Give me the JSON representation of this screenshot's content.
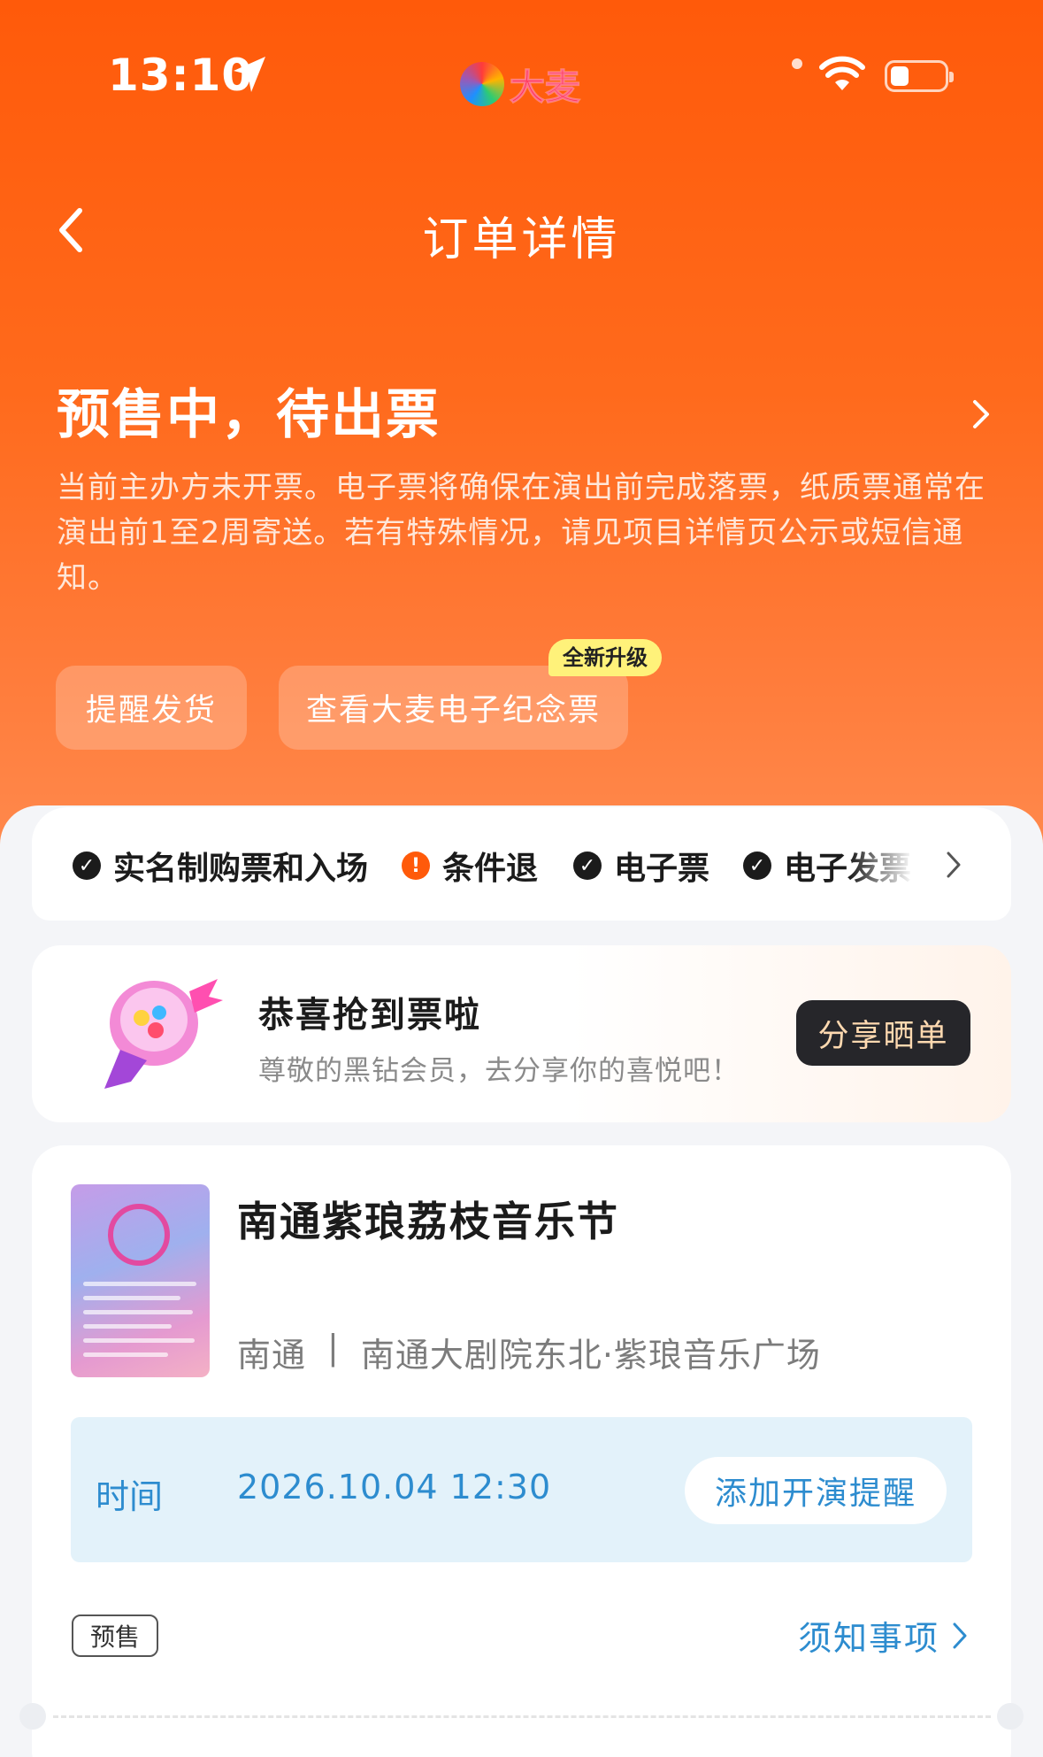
{
  "status_bar": {
    "time": "13:10",
    "brand": "大麦"
  },
  "nav": {
    "title": "订单详情"
  },
  "order": {
    "status": "预售中，待出票",
    "description": "当前主办方未开票。电子票将确保在演出前完成落票，纸质票通常在演出前1至2周寄送。若有特殊情况，请见项目详情页公示或短信通知。"
  },
  "actions": {
    "remind_label": "提醒发货",
    "eticket_label": "查看大麦电子纪念票",
    "new_badge": "全新升级"
  },
  "policies": [
    {
      "label": "实名制购票和入场",
      "icon": "check-circle-icon"
    },
    {
      "label": "条件退",
      "icon": "warning-circle-icon"
    },
    {
      "label": "电子票",
      "icon": "check-circle-icon"
    },
    {
      "label": "电子发票",
      "icon": "check-circle-icon"
    }
  ],
  "share": {
    "title": "恭喜抢到票啦",
    "subtitle": "尊敬的黑钻会员，去分享你的喜悦吧！",
    "button": "分享晒单"
  },
  "event": {
    "title": "南通紫琅荔枝音乐节",
    "city": "南通",
    "separator": "|",
    "venue": "南通大剧院东北·紫琅音乐广场",
    "time_label": "时间",
    "time_value": "2026.10.04 12:30",
    "reminder_button": "添加开演提醒",
    "tag": "预售",
    "notice_link": "须知事项"
  },
  "colors": {
    "brand_orange": "#ff5a0a",
    "link_blue": "#2d8ccf",
    "share_button_bg": "#26262a"
  }
}
